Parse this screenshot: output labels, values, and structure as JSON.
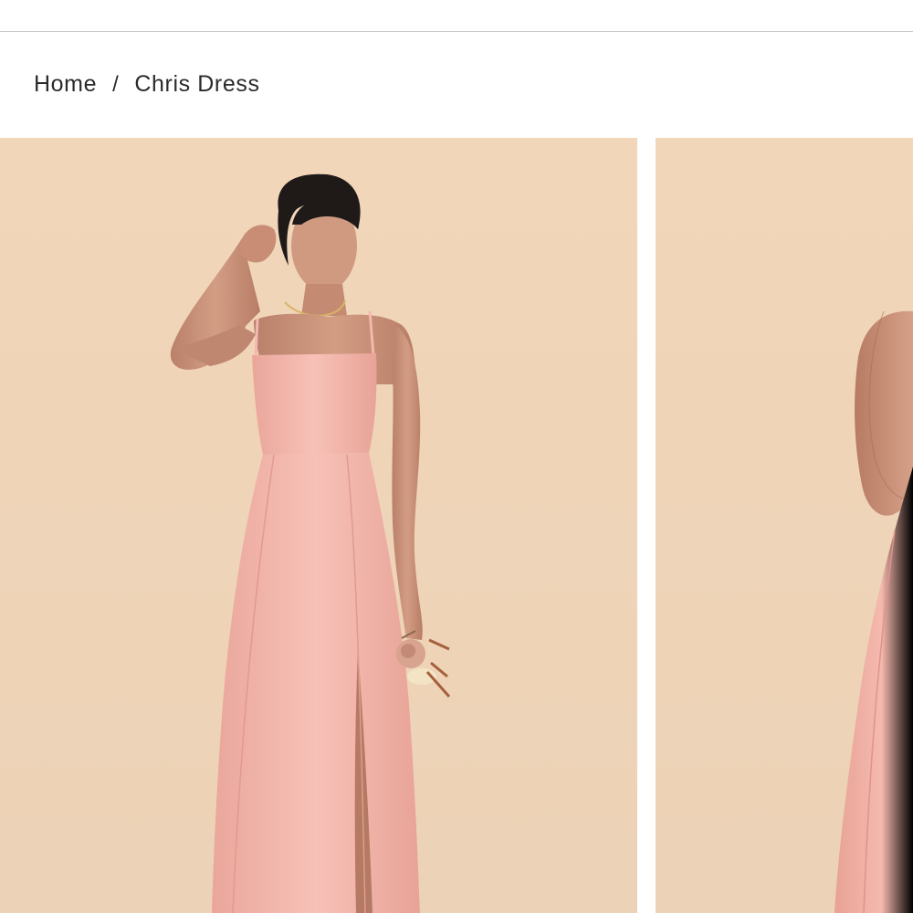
{
  "breadcrumb": {
    "home_label": "Home",
    "separator": "/",
    "current_label": "Chris Dress"
  },
  "gallery": {
    "images": [
      {
        "name": "product-photo-1",
        "alt": "Model wearing blush pink Chris Dress with side slit holding a small bouquet"
      },
      {
        "name": "product-photo-2",
        "alt": "Second model wearing blush pink Chris Dress"
      }
    ]
  },
  "colors": {
    "backdrop": "#efd4b8",
    "dress": "#f4b8ad",
    "skin": "#c99178",
    "hair": "#1f1a18"
  }
}
